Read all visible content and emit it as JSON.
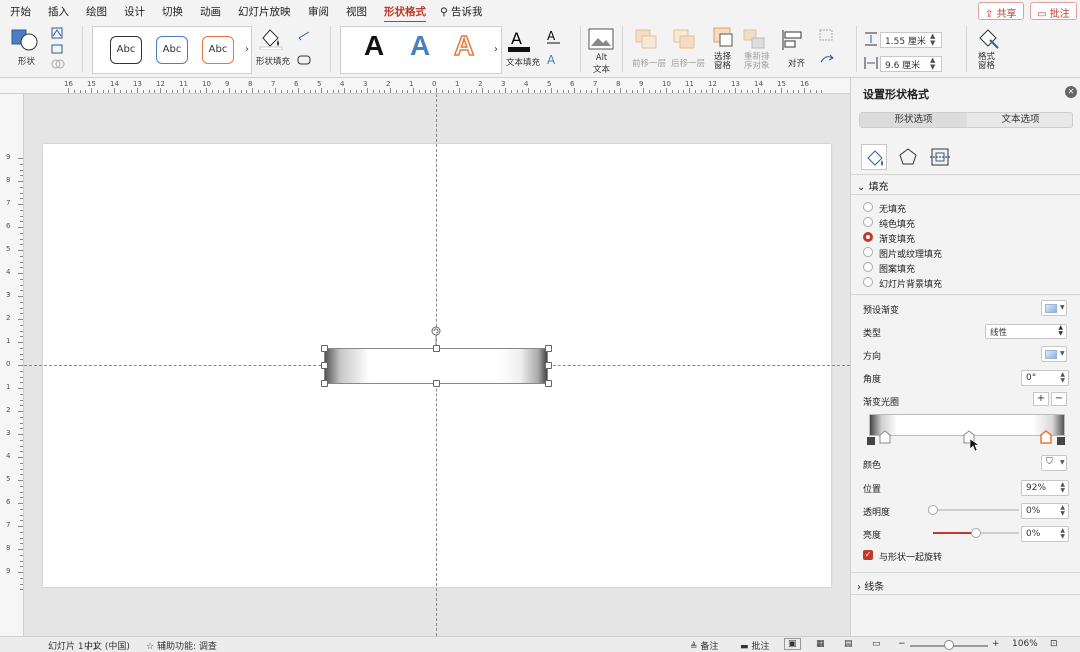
{
  "tabs": [
    "开始",
    "插入",
    "绘图",
    "设计",
    "切换",
    "动画",
    "幻灯片放映",
    "审阅",
    "视图",
    "形状格式",
    "告诉我"
  ],
  "active_tab": "形状格式",
  "top_buttons": {
    "share": "共享",
    "comment": "批注"
  },
  "ribbon": {
    "shape_label": "形状",
    "style_samples": [
      "Abc",
      "Abc",
      "Abc"
    ],
    "shape_fill_label": "形状填充",
    "wordart_letter": "A",
    "text_fill_label": "文本填充",
    "alt_text_label": "Alt\n文本",
    "bring_forward": "前移一层",
    "send_backward": "后移一层",
    "selection_pane": "选择\n窗格",
    "reorder": "重新排\n序对象",
    "align": "对齐",
    "height_value": "1.55 厘米",
    "width_value": "9.6 厘米",
    "format_pane": "格式\n窗格"
  },
  "ruler_labels": [
    "16",
    "15",
    "14",
    "13",
    "12",
    "11",
    "10",
    "9",
    "8",
    "7",
    "6",
    "5",
    "4",
    "3",
    "2",
    "1",
    "0",
    "1",
    "2",
    "3",
    "4",
    "5",
    "6",
    "7",
    "8",
    "9",
    "10",
    "11",
    "12",
    "13",
    "14",
    "15",
    "16"
  ],
  "vruler_labels": [
    "9",
    "8",
    "7",
    "6",
    "5",
    "4",
    "3",
    "2",
    "1",
    "0",
    "1",
    "2",
    "3",
    "4",
    "5",
    "6",
    "7",
    "8",
    "9"
  ],
  "panel": {
    "title": "设置形状格式",
    "seg_shape": "形状选项",
    "seg_text": "文本选项",
    "fill_section": "填充",
    "fill_options": [
      "无填充",
      "纯色填充",
      "渐变填充",
      "图片或纹理填充",
      "图案填充",
      "幻灯片背景填充"
    ],
    "selected_fill": "渐变填充",
    "preset_label": "预设渐变",
    "type_label": "类型",
    "type_value": "线性",
    "direction_label": "方向",
    "angle_label": "角度",
    "angle_value": "0°",
    "stops_label": "渐变光圈",
    "color_label": "颜色",
    "position_label": "位置",
    "position_value": "92%",
    "transparency_label": "透明度",
    "transparency_value": "0%",
    "transparency": 0,
    "brightness_label": "亮度",
    "brightness_value": "0%",
    "brightness": 0,
    "rotate_label": "与形状一起旋转",
    "rotate_checked": true,
    "line_section": "线条"
  },
  "status": {
    "slide": "幻灯片 1 / 1",
    "lang": "中文 (中国)",
    "accessibility": "辅助功能: 调查",
    "notes": "备注",
    "comments": "批注",
    "zoom": "106%"
  },
  "colors": {
    "accent": "#c0392b"
  }
}
